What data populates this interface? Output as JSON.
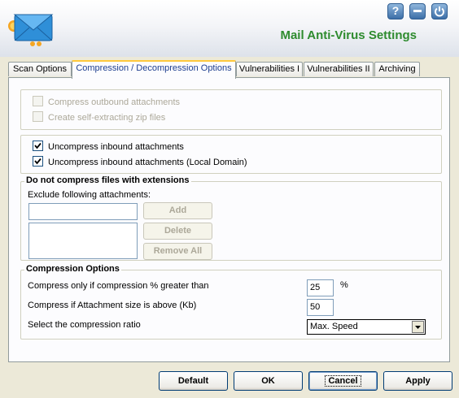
{
  "header": {
    "title": "Mail Anti-Virus Settings",
    "help_label": "?",
    "minimize_icon": "minimize-icon",
    "power_icon": "power-icon",
    "logo_icon": "envelope-logo-icon"
  },
  "tabs": [
    {
      "label": "Scan Options",
      "active": false
    },
    {
      "label": "Compression / Decompression Options",
      "active": true
    },
    {
      "label": "Vulnerabilities I",
      "active": false
    },
    {
      "label": "Vulnerabilities II",
      "active": false
    },
    {
      "label": "Archiving",
      "active": false
    }
  ],
  "compress_group": {
    "outbound": {
      "label": "Compress outbound attachments",
      "checked": false,
      "enabled": false
    },
    "selfextract": {
      "label": "Create self-extracting zip files",
      "checked": false,
      "enabled": false
    }
  },
  "uncompress_group": {
    "inbound": {
      "label": "Uncompress inbound attachments",
      "checked": true
    },
    "local": {
      "label": "Uncompress inbound attachments (Local Domain)",
      "checked": true
    }
  },
  "exclude_group": {
    "title": "Do not compress files with extensions",
    "subtitle": "Exclude following attachments:",
    "input_value": "",
    "add_label": "Add",
    "delete_label": "Delete",
    "remove_all_label": "Remove All"
  },
  "compression_options": {
    "title": "Compression Options",
    "percent_label": "Compress only if compression % greater than",
    "percent_value": "25",
    "percent_unit": "%",
    "size_label": "Compress if Attachment size is above (Kb)",
    "size_value": "50",
    "ratio_label": "Select the compression ratio",
    "ratio_value": "Max. Speed"
  },
  "footer": {
    "default_label": "Default",
    "ok_label": "OK",
    "cancel_label": "Cancel",
    "apply_label": "Apply"
  },
  "colors": {
    "title_green": "#2e8b2e",
    "active_tab_text": "#1f3f8f",
    "tab_accent": "#ffc83c"
  }
}
